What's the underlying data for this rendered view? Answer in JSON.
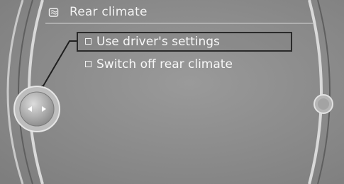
{
  "header": {
    "title": "Rear climate",
    "icon": "climate-settings-icon"
  },
  "menu": {
    "items": [
      {
        "label": "Use driver's settings",
        "selected": true
      },
      {
        "label": "Switch off rear climate",
        "selected": false
      }
    ]
  },
  "controller": {
    "icon": "controller-left-right-icon"
  },
  "colors": {
    "screen_background": "#8e8e8e",
    "text": "#f7f7f7",
    "selection_border": "#2a2a2a"
  }
}
